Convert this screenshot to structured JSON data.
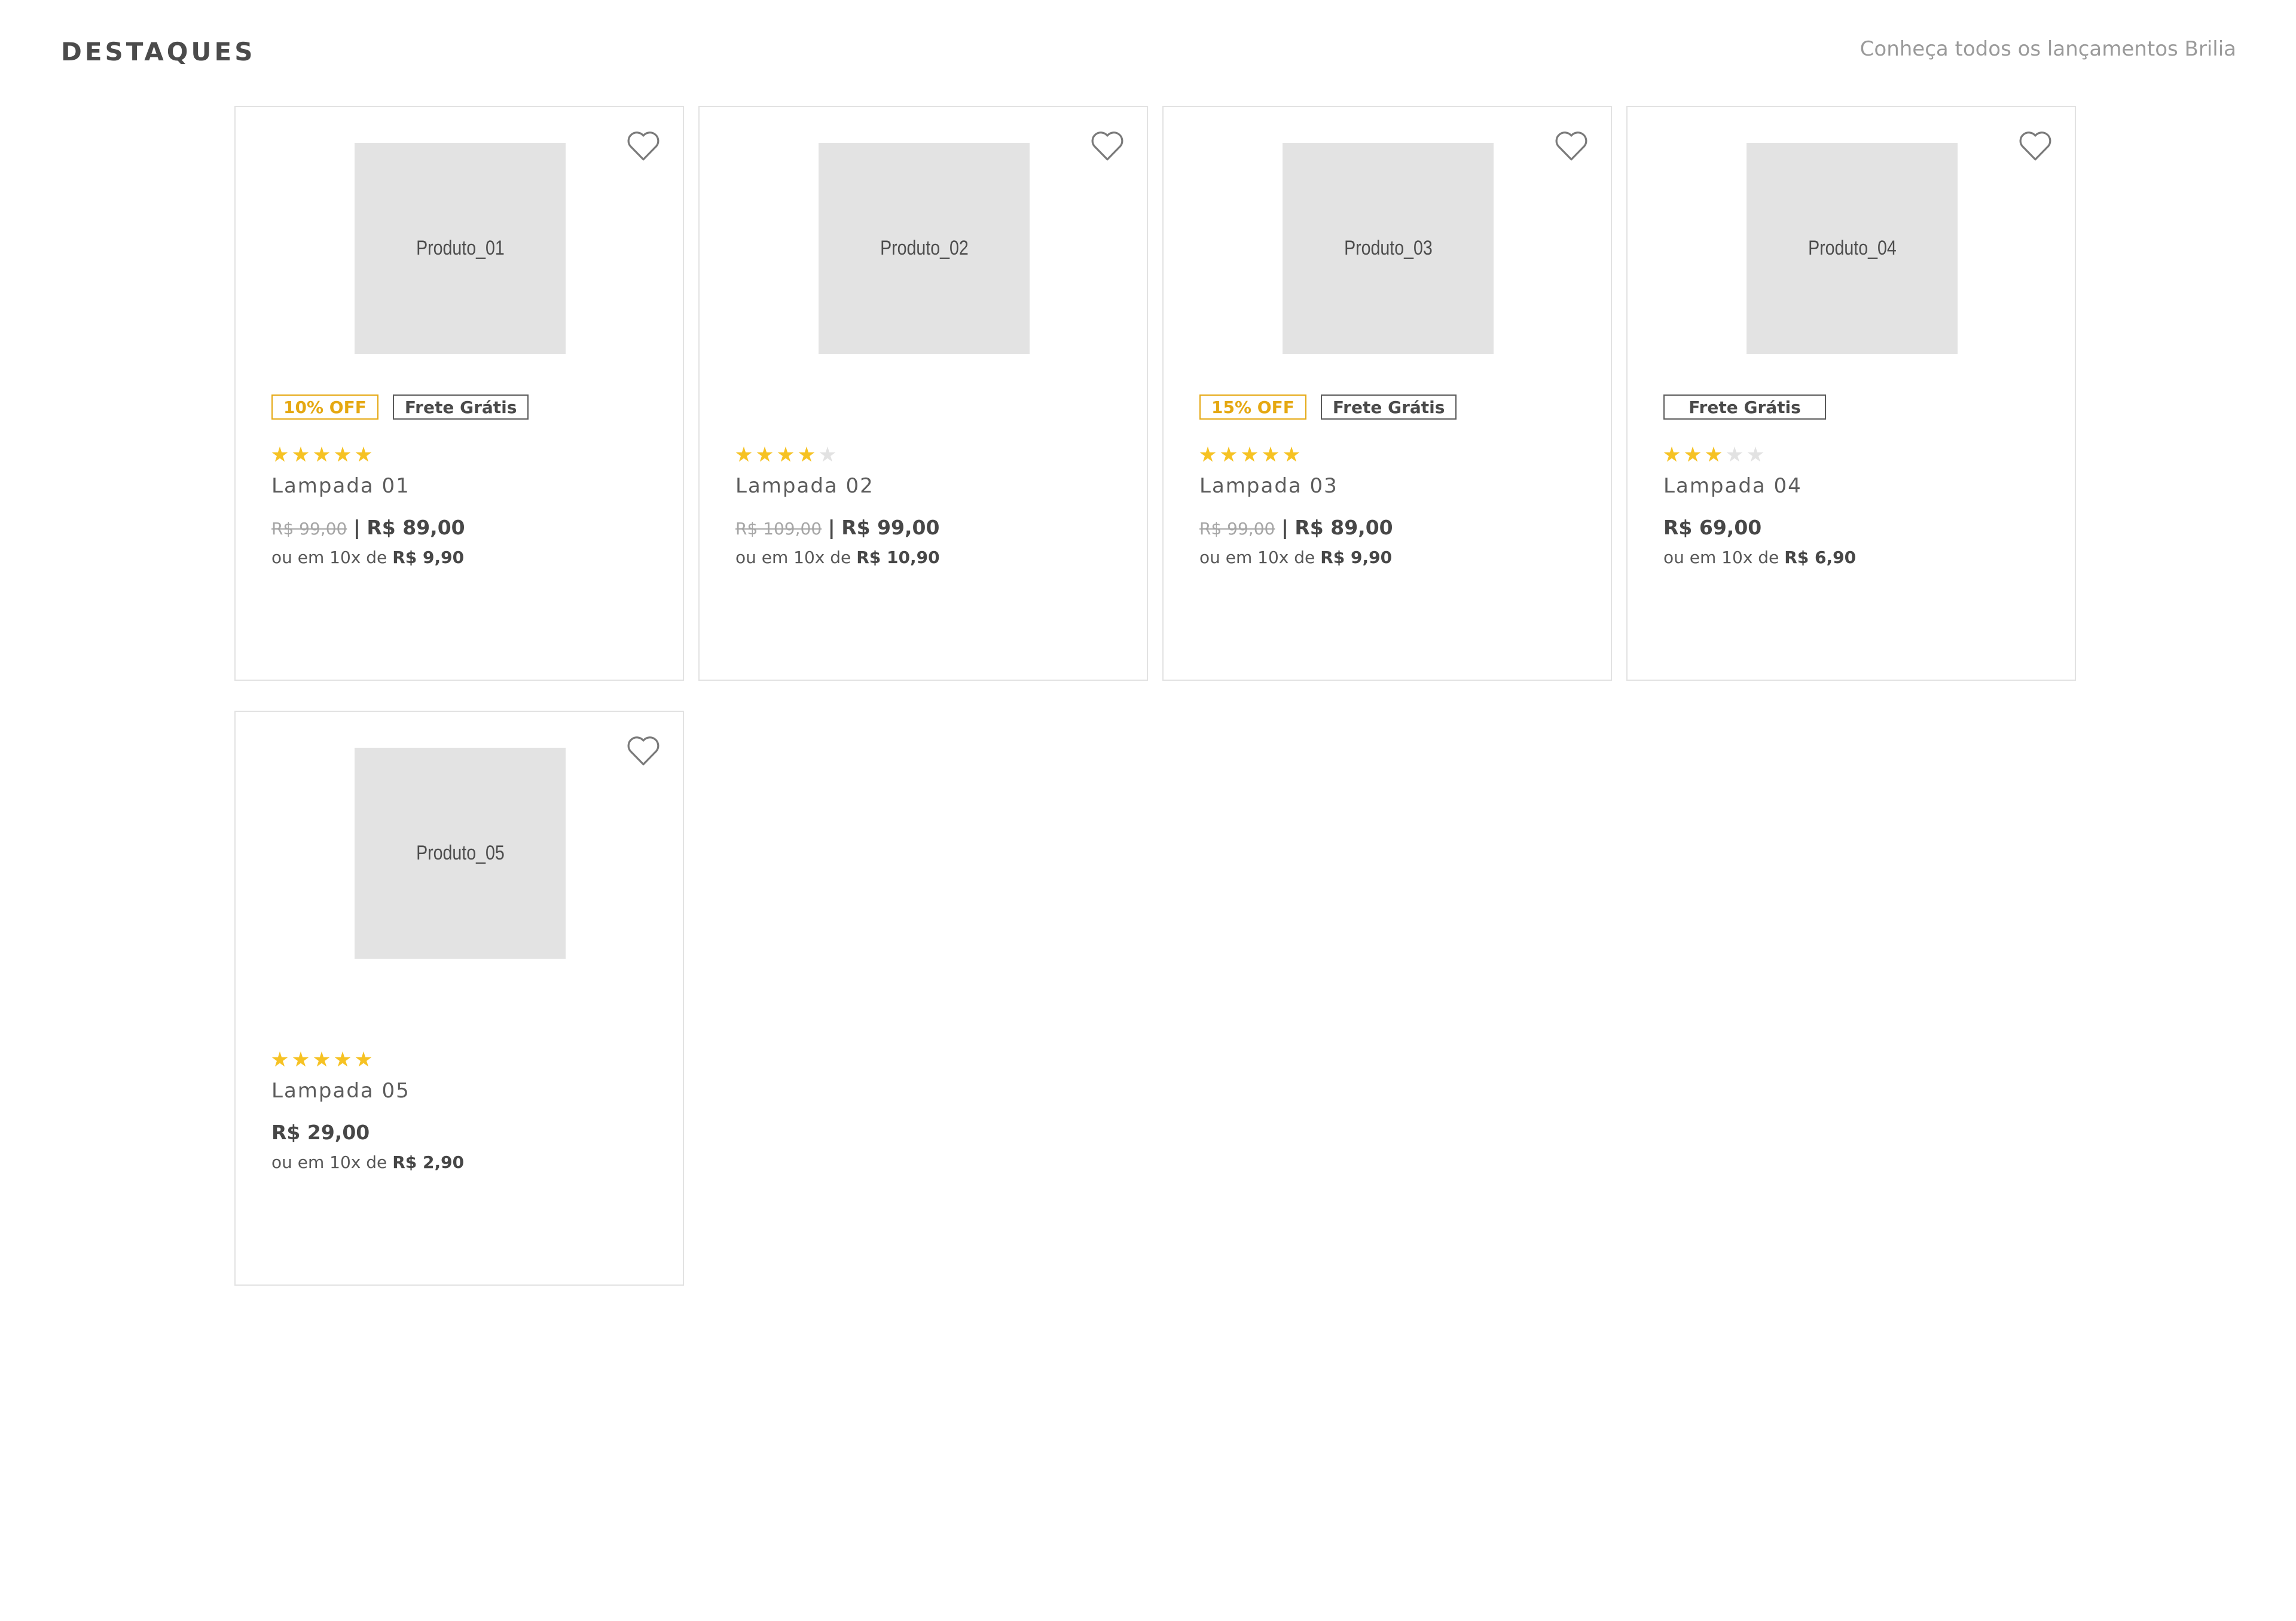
{
  "header": {
    "title": "DESTAQUES",
    "link_label": "Conheça todos os lançamentos Brilia"
  },
  "colors": {
    "accent_discount": "#e5a812",
    "star_on": "#f6c223",
    "star_off": "#e2e2e2",
    "placeholder": "#e3e3e3"
  },
  "products": [
    {
      "image_label": "Produto_01",
      "discount": "10% OFF",
      "shipping": "Frete Grátis",
      "rating": 5,
      "name": "Lampada 01",
      "old_price": "R$ 99,00",
      "separator": "|",
      "price": "R$ 89,00",
      "installment_prefix": "ou em 10x de",
      "installment_value": "R$ 9,90"
    },
    {
      "image_label": "Produto_02",
      "discount": "",
      "shipping": "",
      "rating": 4,
      "name": "Lampada 02",
      "old_price": "R$ 109,00",
      "separator": "|",
      "price": "R$ 99,00",
      "installment_prefix": "ou em 10x de",
      "installment_value": "R$ 10,90"
    },
    {
      "image_label": "Produto_03",
      "discount": "15% OFF",
      "shipping": "Frete Grátis",
      "rating": 5,
      "name": "Lampada 03",
      "old_price": "R$ 99,00",
      "separator": "|",
      "price": "R$ 89,00",
      "installment_prefix": "ou em 10x de",
      "installment_value": "R$ 9,90"
    },
    {
      "image_label": "Produto_04",
      "discount": "",
      "shipping": "Frete Grátis",
      "rating": 3,
      "name": "Lampada 04",
      "old_price": "",
      "separator": "",
      "price": "R$ 69,00",
      "installment_prefix": "ou em 10x de",
      "installment_value": "R$ 6,90"
    },
    {
      "image_label": "Produto_05",
      "discount": "",
      "shipping": "",
      "rating": 5,
      "name": "Lampada 05",
      "old_price": "",
      "separator": "",
      "price": "R$ 29,00",
      "installment_prefix": "ou em 10x de",
      "installment_value": "R$ 2,90"
    }
  ]
}
